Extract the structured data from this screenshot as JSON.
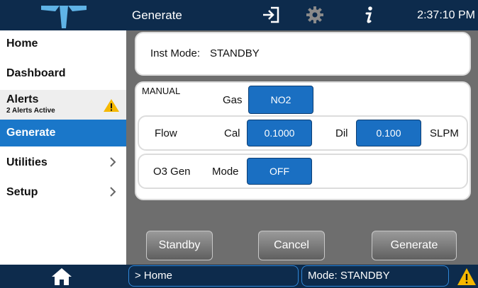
{
  "header": {
    "title": "Generate",
    "time": "2:37:10 PM",
    "icons": [
      "logo-icon",
      "logout-icon",
      "gear-icon",
      "info-icon"
    ]
  },
  "sidebar": {
    "items": [
      {
        "label": "Home"
      },
      {
        "label": "Dashboard"
      },
      {
        "label": "Alerts",
        "sublabel": "2 Alerts Active",
        "icon": "warning-icon"
      },
      {
        "label": "Generate",
        "selected": true
      },
      {
        "label": "Utilities",
        "icon": "chevron-right-icon"
      },
      {
        "label": "Setup",
        "icon": "chevron-right-icon"
      }
    ]
  },
  "main": {
    "inst_mode_label": "Inst Mode:",
    "inst_mode_value": "STANDBY",
    "manual_label": "MANUAL",
    "gas_label": "Gas",
    "gas_value": "NO2",
    "flow_label": "Flow",
    "cal_label": "Cal",
    "cal_value": "0.1000",
    "dil_label": "Dil",
    "dil_value": "0.100",
    "unit_label": "SLPM",
    "o3_label": "O3 Gen",
    "o3_mode_label": "Mode",
    "o3_mode_value": "OFF",
    "buttons": {
      "standby": "Standby",
      "cancel": "Cancel",
      "generate": "Generate"
    }
  },
  "footer": {
    "breadcrumb": "> Home",
    "mode": "Mode: STANDBY",
    "icons": [
      "home-icon",
      "warning-icon"
    ]
  },
  "colors": {
    "dark_navy": "#0d2b4c",
    "accent_blue": "#1a77c9",
    "button_blue": "#1a6fc2",
    "warning_yellow": "#f5b800",
    "panel_gray": "#6e6e6e"
  }
}
